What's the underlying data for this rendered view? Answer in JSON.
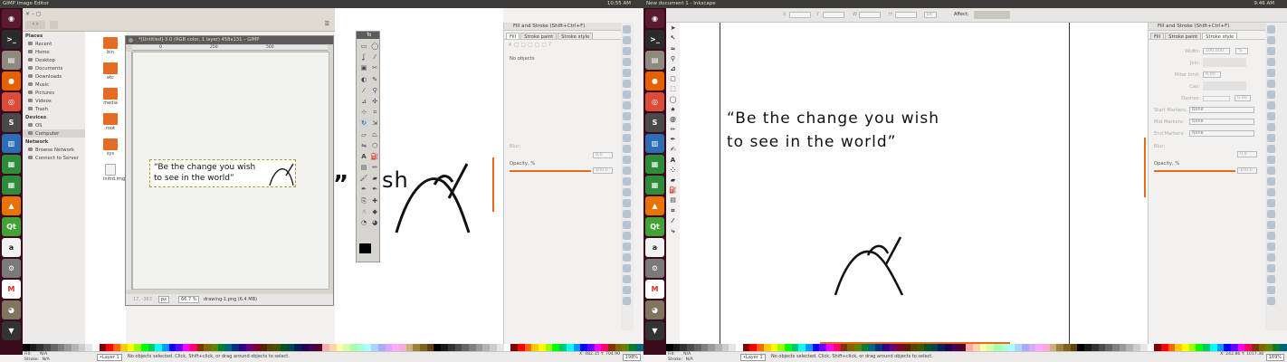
{
  "left": {
    "topbar": {
      "title": "GIMP Image Editor",
      "clock": "10:55 AM"
    },
    "nautilus": {
      "sections": [
        {
          "title": "Places",
          "items": [
            "Recent",
            "Home",
            "Desktop",
            "Documents",
            "Downloads",
            "Music",
            "Pictures",
            "Videos",
            "Trash"
          ]
        },
        {
          "title": "Devices",
          "items": [
            "OS",
            "Computer"
          ]
        },
        {
          "title": "Network",
          "items": [
            "Browse Network",
            "Connect to Server"
          ]
        }
      ],
      "files": [
        "bin",
        "etc",
        "media",
        "root",
        "sys",
        "initrd.img"
      ]
    },
    "gimp": {
      "title": "*[Untitled]-3.0 (RGB color, 1 layer) 458x131 – GIMP",
      "ruler_marks": [
        "0",
        "250",
        "500"
      ],
      "text_line1": "“Be the change you wish",
      "text_line2": "to see in the world”",
      "coords": "17, -363",
      "unit": "px",
      "zoom": "66.7 %",
      "file_info": "drawing-1.png (6.4 MB)",
      "toolbox_title": "To"
    },
    "inkscape_background": {
      "panel_title": "Fill and Stroke (Shift+Ctrl+F)",
      "tabs": [
        "Fill",
        "Stroke paint",
        "Stroke style"
      ],
      "no_objects": "No objects",
      "blur_label": "Blur:",
      "blur_value": "0.0",
      "opacity_label": "Opacity, %",
      "opacity_value": "100.0",
      "canvas_fragment": "sh"
    },
    "statusbar": {
      "fill_label": "Fill:",
      "stroke_label": "Stroke:",
      "fill_val": "N/A",
      "stroke_val": "N/A",
      "layer": "•Layer 1",
      "message": "No objects selected. Click, Shift+click, or drag around objects to select.",
      "xy": "X: 482.35  Y: 704.90",
      "zoom": "198%"
    }
  },
  "right": {
    "topbar": {
      "title": "New document 1 - Inkscape",
      "clock": "9:46 AM"
    },
    "toolbar": {
      "x": "X",
      "y": "Y",
      "w": "W",
      "h": "H",
      "unit": "px",
      "affect": "Affect:"
    },
    "canvas": {
      "line1": "“Be the change you wish",
      "line2": "to see in the world”"
    },
    "panel": {
      "title": "Fill and Stroke (Shift+Ctrl+F)",
      "tabs": [
        "Fill",
        "Stroke paint",
        "Stroke style"
      ],
      "width_label": "Width:",
      "width_value": "100.000",
      "width_unit": "%",
      "join_label": "Join:",
      "miter_label": "Miter limit:",
      "miter_value": "4.00",
      "cap_label": "Cap:",
      "dashes_label": "Dashes:",
      "dashes_value": "0.00",
      "start_label": "Start Markers:",
      "mid_label": "Mid Markers:",
      "end_label": "End Markers:",
      "marker_value": "None",
      "blur_label": "Blur:",
      "blur_value": "0.0",
      "opacity_label": "Opacity, %",
      "opacity_value": "100.0"
    },
    "statusbar": {
      "fill_label": "Fill:",
      "stroke_label": "Stroke:",
      "fill_val": "N/A",
      "stroke_val": "N/A",
      "layer": "•Layer 1",
      "message": "No objects selected. Click, Shift+click, or drag around objects to select.",
      "xy": "X: 242.86  Y: 1017.38",
      "zoom": "169%"
    }
  },
  "launcher_icons": [
    "ubuntu-dash-icon",
    "terminal-icon",
    "files-icon",
    "firefox-icon",
    "chrome-icon",
    "sublime-icon",
    "writer-icon",
    "calc-icon",
    "impress-icon",
    "vlc-icon",
    "qt-icon",
    "amazon-icon",
    "settings-icon",
    "gmail-icon",
    "gimp-icon",
    "inkscape-icon",
    "software-icon"
  ],
  "colors": {
    "accent": "#e46b24",
    "launcher": "#3a0a1e",
    "panel": "#3c3b37"
  }
}
